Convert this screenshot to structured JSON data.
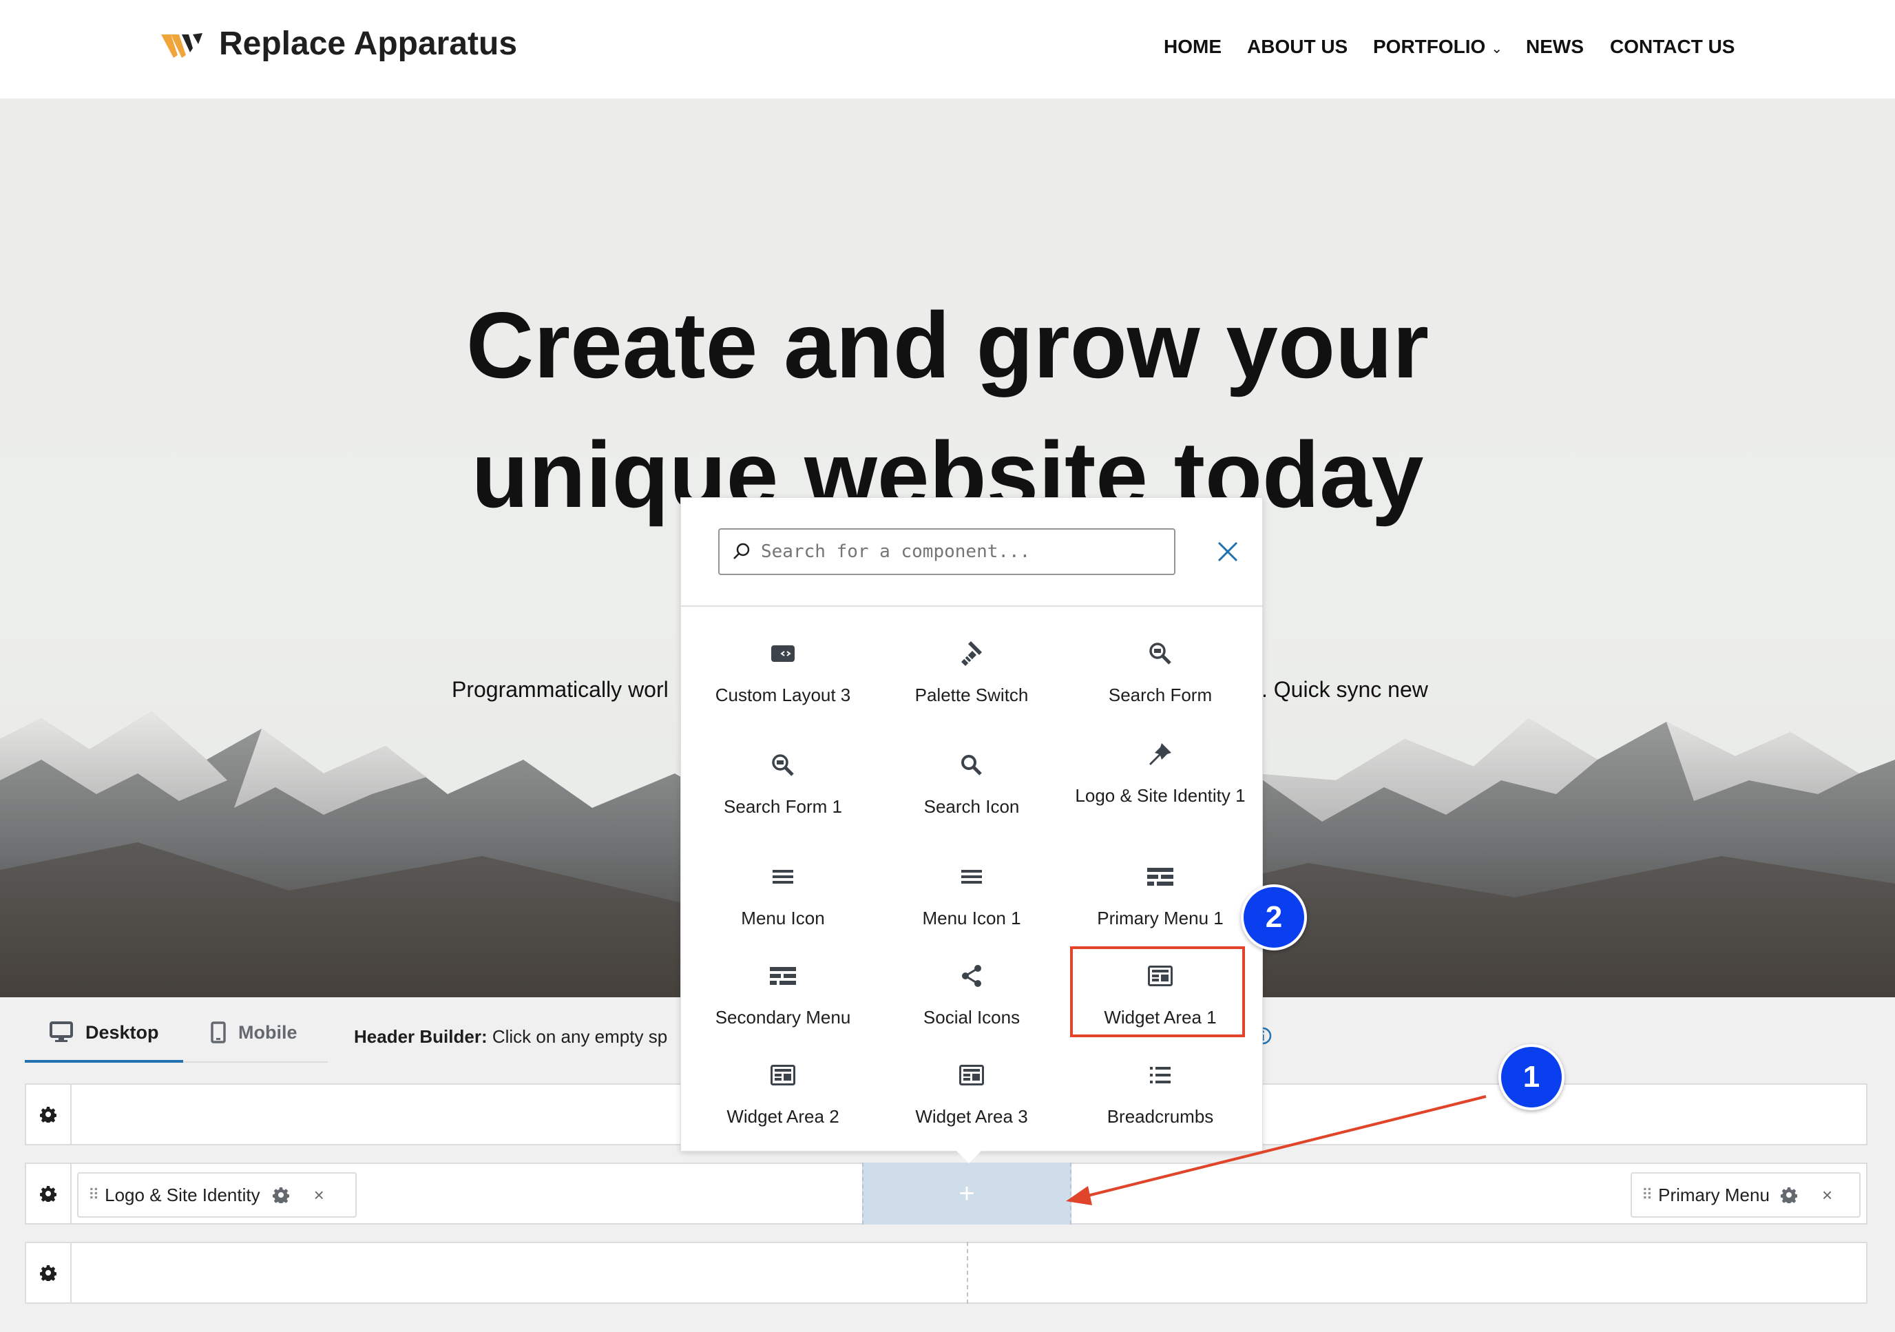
{
  "site": {
    "title": "Replace Apparatus",
    "nav": [
      "HOME",
      "ABOUT US",
      "PORTFOLIO",
      "NEWS",
      "CONTACT US"
    ],
    "nav_chevron": "⌄"
  },
  "hero": {
    "title_line1": "Create and grow your",
    "title_line2": "unique website today",
    "sub_left": "Programmatically worl",
    "sub_right": ". Quick sync new"
  },
  "builder": {
    "tab_desktop": "Desktop",
    "tab_mobile": "Mobile",
    "label_bold": "Header Builder:",
    "label_text": " Click on any empty sp",
    "chip_logo": "Logo & Site Identity",
    "chip_menu": "Primary Menu",
    "add_symbol": "+"
  },
  "popup": {
    "search_placeholder": "Search for a component...",
    "components": [
      {
        "label": "Custom Layout 3",
        "icon": "custom-layout-icon"
      },
      {
        "label": "Palette Switch",
        "icon": "palette-icon"
      },
      {
        "label": "Search Form",
        "icon": "search-form-icon"
      },
      {
        "label": "Search Form 1",
        "icon": "search-form-icon"
      },
      {
        "label": "Search Icon",
        "icon": "search-icon"
      },
      {
        "label": "Logo & Site Identity 1",
        "icon": "pin-icon"
      },
      {
        "label": "Menu Icon",
        "icon": "hamburger-icon"
      },
      {
        "label": "Menu Icon 1",
        "icon": "hamburger-icon"
      },
      {
        "label": "Primary Menu 1",
        "icon": "menu-grid-icon"
      },
      {
        "label": "Secondary Menu",
        "icon": "menu-grid-icon"
      },
      {
        "label": "Social Icons",
        "icon": "share-icon"
      },
      {
        "label": "Widget Area 1",
        "icon": "widget-icon"
      },
      {
        "label": "Widget Area 2",
        "icon": "widget-icon"
      },
      {
        "label": "Widget Area 3",
        "icon": "widget-icon"
      },
      {
        "label": "Breadcrumbs",
        "icon": "list-icon"
      }
    ]
  },
  "annotations": {
    "badge1": "1",
    "badge2": "2",
    "arrow_color": "#e0442a",
    "badge_color": "#0a3ff0"
  }
}
